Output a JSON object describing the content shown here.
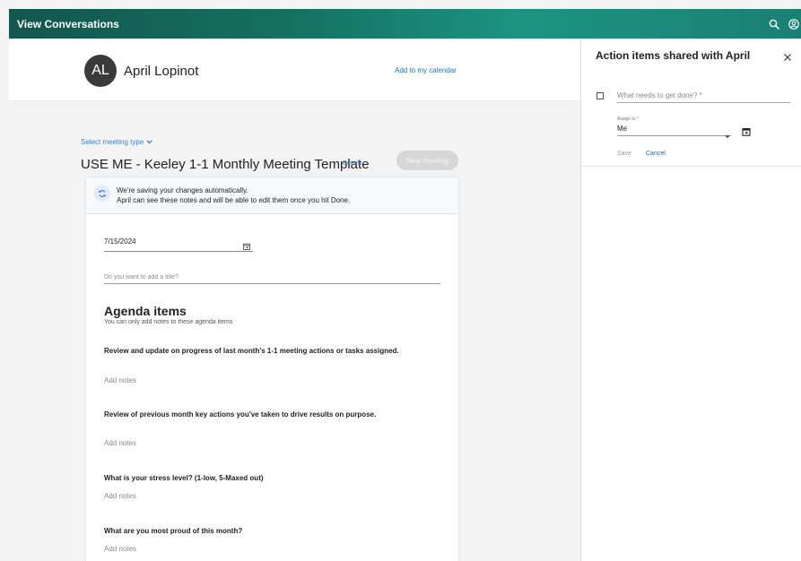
{
  "header": {
    "title": "View Conversations",
    "icons": [
      "search-icon",
      "account-icon"
    ]
  },
  "profile": {
    "initials": "AL",
    "name": "April Lopinot",
    "calendar_link": "Add to my calendar"
  },
  "meeting": {
    "type_selector": "Select meeting type",
    "template_title": "USE ME - Keeley 1-1 Monthly Meeting Template",
    "details_link": "Details",
    "new_meeting_label": "New meeting"
  },
  "notice": {
    "line1": "We're saving your changes automatically.",
    "line2": "April can see these notes and will be able to edit them once you hit Done."
  },
  "form": {
    "date": "7/15/2024",
    "title_placeholder": "Do you want to add a title?"
  },
  "agenda": {
    "heading": "Agenda items",
    "subheading": "You can only add notes to these agenda items",
    "items": [
      {
        "title": "Review and update on progress of last month's 1-1 meeting actions or tasks assigned.",
        "notes_placeholder": "Add notes"
      },
      {
        "title": "Review of previous month key actions you've taken to drive results on purpose.",
        "notes_placeholder": "Add notes"
      },
      {
        "title": "What is your stress level?  (1-low, 5-Maxed out)",
        "notes_placeholder": "Add notes"
      },
      {
        "title": "What are you most proud of this month?",
        "notes_placeholder": "Add notes"
      }
    ]
  },
  "action_panel": {
    "title": "Action items shared with April",
    "todo_placeholder": "What needs to get done? *",
    "assign_label": "Assign to *",
    "assign_value": "Me",
    "save_label": "Save",
    "cancel_label": "Cancel"
  },
  "colors": {
    "header_gradient_start": "#13564f",
    "header_gradient_mid": "#1d9483",
    "link_blue": "#1a73b7",
    "avatar_bg": "#3a3a3a"
  }
}
